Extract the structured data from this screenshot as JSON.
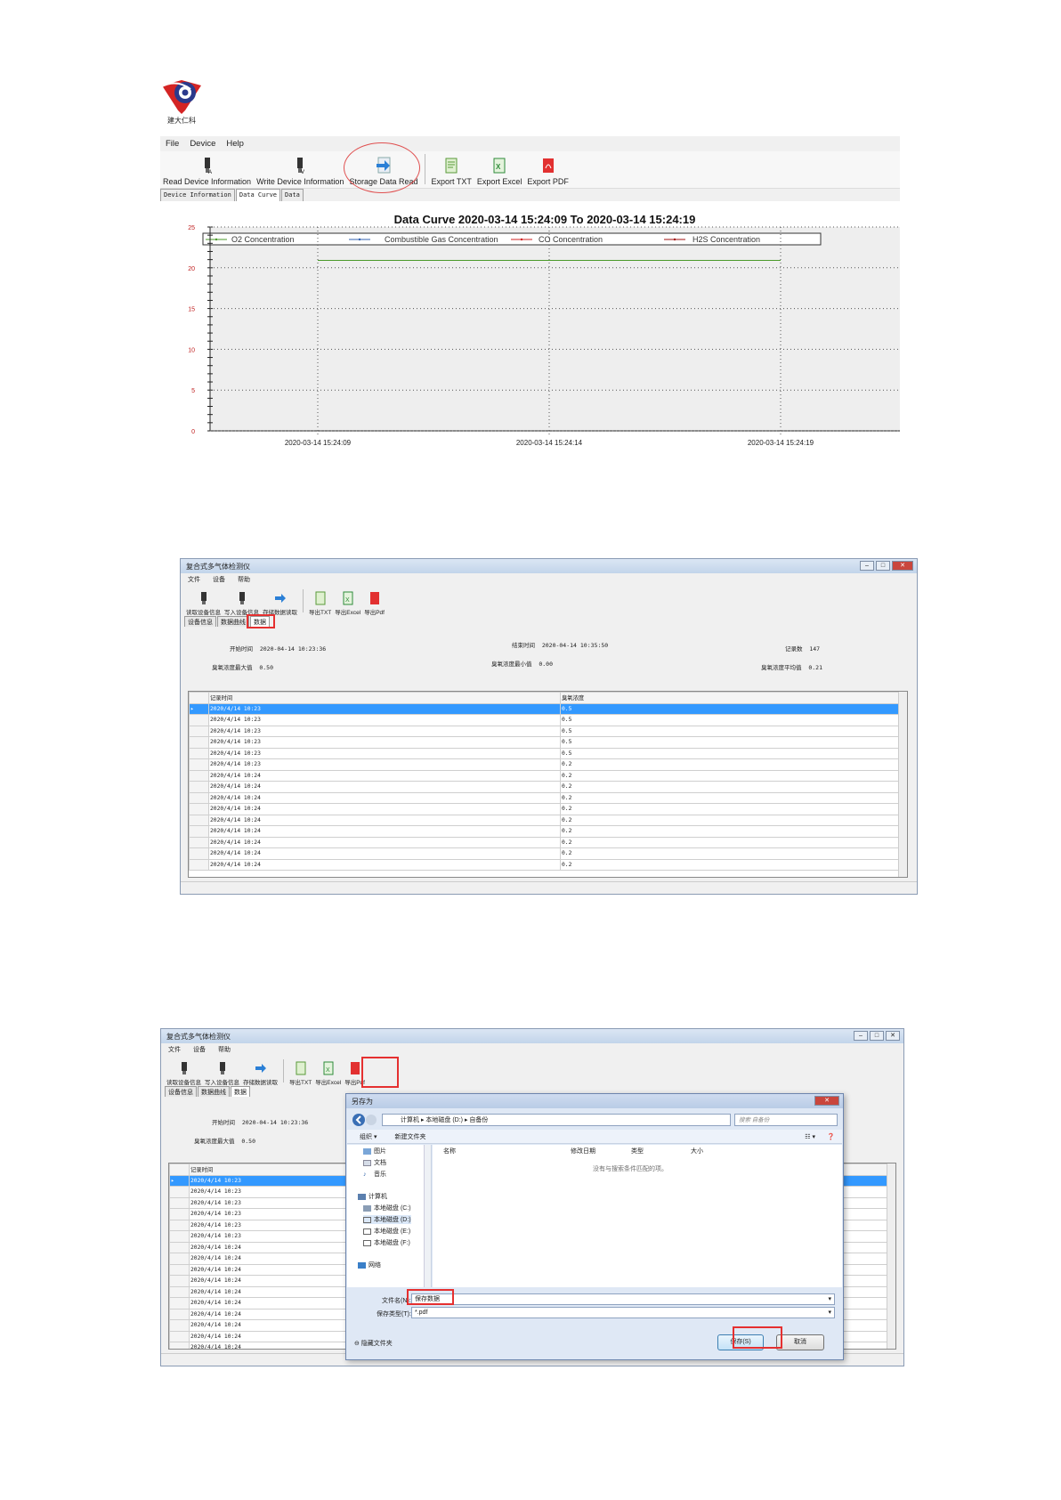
{
  "logo": {
    "text": "建大仁科"
  },
  "panel1": {
    "menu": [
      "File",
      "Device",
      "Help"
    ],
    "toolbar": [
      "Read Device Information",
      "Write Device Information",
      "Storage Data Read",
      "Export TXT",
      "Export Excel",
      "Export PDF"
    ],
    "tabs": [
      "Device Information",
      "Data Curve",
      "Data"
    ]
  },
  "chart_data": {
    "type": "line",
    "title": "Data Curve 2020-03-14 15:24:09 To 2020-03-14 15:24:19",
    "x": [
      "2020-03-14 15:24:09",
      "2020-03-14 15:24:14",
      "2020-03-14 15:24:19"
    ],
    "series": [
      {
        "name": "O2 Concentration",
        "color": "#4a9a2a",
        "values": [
          20.9,
          20.9,
          20.9
        ]
      },
      {
        "name": "Combustible Gas Concentration",
        "color": "#3060b0",
        "values": []
      },
      {
        "name": "CO Concentration",
        "color": "#d02020",
        "values": []
      },
      {
        "name": "H2S Concentration",
        "color": "#a01010",
        "values": []
      }
    ],
    "ylim": [
      0,
      25
    ],
    "yticks": [
      "0",
      "5",
      "10",
      "15",
      "20",
      "25"
    ],
    "grid": true,
    "legend": "top"
  },
  "panel2": {
    "title": "复合式多气体检测仪",
    "menu": [
      "文件",
      "设备",
      "帮助"
    ],
    "toolbar": [
      "读取设备信息",
      "写入设备信息",
      "存储数据读取",
      "导出TXT",
      "导出Excel",
      "导出Pdf"
    ],
    "tabs": [
      "设备信息",
      "数据曲线",
      "数据"
    ],
    "info": {
      "start_label": "开始时间",
      "start_value": "2020-04-14 10:23:36",
      "end_label": "结束时间",
      "end_value": "2020-04-14 10:35:50",
      "count_label": "记录数",
      "count_value": "147",
      "max_label": "臭氧浓度最大值",
      "max_value": "0.50",
      "min_label": "臭氧浓度最小值",
      "min_value": "0.00",
      "avg_label": "臭氧浓度平均值",
      "avg_value": "0.21"
    },
    "columns": [
      "记录时间",
      "臭氧浓度"
    ],
    "rows": [
      [
        "2020/4/14 10:23",
        "0.5"
      ],
      [
        "2020/4/14 10:23",
        "0.5"
      ],
      [
        "2020/4/14 10:23",
        "0.5"
      ],
      [
        "2020/4/14 10:23",
        "0.5"
      ],
      [
        "2020/4/14 10:23",
        "0.5"
      ],
      [
        "2020/4/14 10:23",
        "0.2"
      ],
      [
        "2020/4/14 10:24",
        "0.2"
      ],
      [
        "2020/4/14 10:24",
        "0.2"
      ],
      [
        "2020/4/14 10:24",
        "0.2"
      ],
      [
        "2020/4/14 10:24",
        "0.2"
      ],
      [
        "2020/4/14 10:24",
        "0.2"
      ],
      [
        "2020/4/14 10:24",
        "0.2"
      ],
      [
        "2020/4/14 10:24",
        "0.2"
      ],
      [
        "2020/4/14 10:24",
        "0.2"
      ]
    ],
    "partial_row": [
      "2020/4/14 10:24",
      "0.2"
    ]
  },
  "panel3": {
    "title": "复合式多气体检测仪",
    "menu": [
      "文件",
      "设备",
      "帮助"
    ],
    "toolbar": [
      "读取设备信息",
      "写入设备信息",
      "存储数据读取",
      "导出TXT",
      "导出Excel",
      "导出Pdf"
    ],
    "tabs": [
      "设备信息",
      "数据曲线",
      "数据"
    ],
    "start_label": "开始时间",
    "start_value": "2020-04-14 10:23:36",
    "max_label": "臭氧浓度最大值",
    "max_value": "0.50",
    "col": "记录时间",
    "rows": [
      "2020/4/14 10:23",
      "2020/4/14 10:23",
      "2020/4/14 10:23",
      "2020/4/14 10:23",
      "2020/4/14 10:23",
      "2020/4/14 10:23",
      "2020/4/14 10:24",
      "2020/4/14 10:24",
      "2020/4/14 10:24",
      "2020/4/14 10:24",
      "2020/4/14 10:24",
      "2020/4/14 10:24",
      "2020/4/14 10:24",
      "2020/4/14 10:24",
      "2020/4/14 10:24"
    ],
    "partial_row": "2020/4/14 10:24"
  },
  "dialog": {
    "title": "另存为",
    "breadcrumb": "计算机 ▸ 本地磁盘 (D:) ▸ 自备份",
    "search_placeholder": "搜索 自备份",
    "organize": "组织 ▾",
    "new_folder": "新建文件夹",
    "nav": [
      "图片",
      "文档",
      "音乐",
      "计算机",
      "本地磁盘 (C:)",
      "本地磁盘 (D:)",
      "本地磁盘 (E:)",
      "本地磁盘 (F:)",
      "网络"
    ],
    "columns": [
      "名称",
      "修改日期",
      "类型",
      "大小"
    ],
    "empty": "没有与搜索条件匹配的项。",
    "filename_label": "文件名(N):",
    "filename_value": "保存数据",
    "filetype_label": "保存类型(T):",
    "filetype_value": "*.pdf",
    "hide_folders": "隐藏文件夹",
    "save": "保存(S)",
    "cancel": "取消"
  }
}
